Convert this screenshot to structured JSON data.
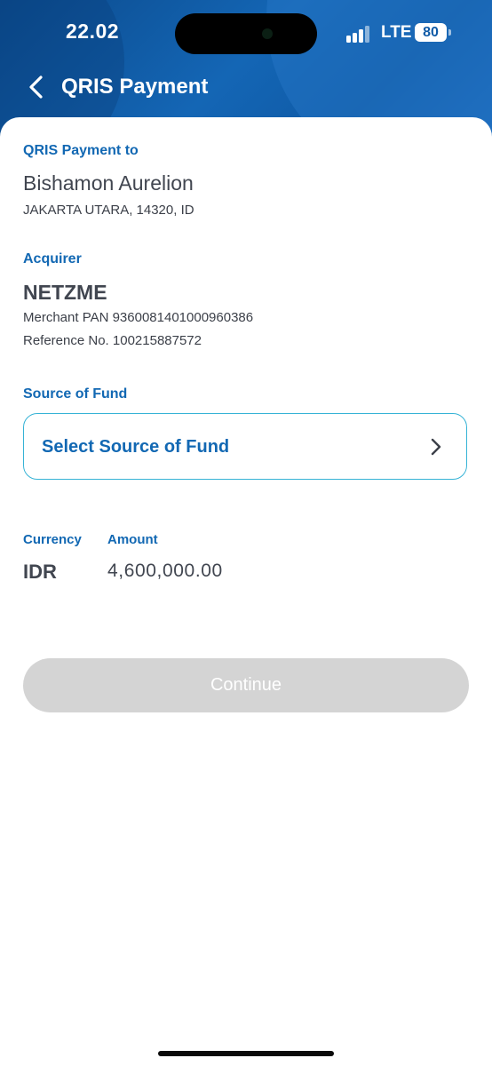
{
  "status_bar": {
    "time": "22.02",
    "network": "LTE",
    "battery": "80"
  },
  "header": {
    "title": "QRIS Payment"
  },
  "payment_to": {
    "label": "QRIS Payment to",
    "merchant_name": "Bishamon Aurelion",
    "merchant_location": "JAKARTA UTARA, 14320, ID"
  },
  "acquirer": {
    "label": "Acquirer",
    "name": "NETZME",
    "merchant_pan": "Merchant PAN 9360081401000960386",
    "reference": "Reference No. 100215887572"
  },
  "source_of_fund": {
    "label": "Source of Fund",
    "select_label": "Select Source of Fund"
  },
  "payment": {
    "currency_label": "Currency",
    "currency_value": "IDR",
    "amount_label": "Amount",
    "amount_value": "4,600,000.00"
  },
  "actions": {
    "continue_label": "Continue"
  },
  "icons": {
    "back": "chevron-left-icon",
    "select": "chevron-right-icon"
  },
  "colors": {
    "accent": "#1268b3",
    "header_blue": "#0f5aa6",
    "border_cyan": "#36b3d6",
    "disabled_button": "#d4d4d4"
  }
}
